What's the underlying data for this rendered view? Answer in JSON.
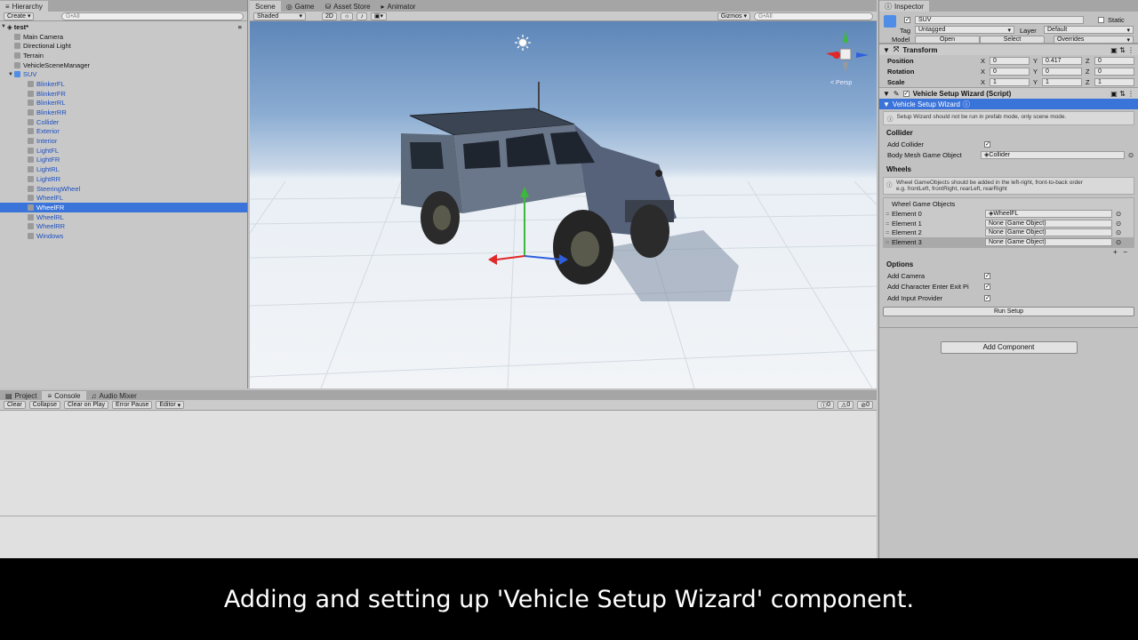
{
  "hierarchy": {
    "tab_label": "Hierarchy",
    "create_label": "Create",
    "search_placeholder": "G•All",
    "scene_name": "test*",
    "roots": [
      "Main Camera",
      "Directional Light",
      "Terrain",
      "VehicleSceneManager",
      "SUV"
    ],
    "children": [
      "BlinkerFL",
      "BlinkerFR",
      "BlinkerRL",
      "BlinkerRR",
      "Collider",
      "Exterior",
      "Interior",
      "LightFL",
      "LightFR",
      "LightRL",
      "LightRR",
      "SteeringWheel",
      "WheelFL",
      "WheelFR",
      "WheelRL",
      "WheelRR",
      "Windows"
    ],
    "selected": "WheelFR"
  },
  "scene": {
    "tabs": [
      "Scene",
      "Game",
      "Asset Store",
      "Animator"
    ],
    "shading": "Shaded",
    "mode_2d": "2D",
    "gizmos": "Gizmos",
    "search_placeholder": "G•All",
    "persp_label": "< Persp"
  },
  "inspector": {
    "tab_label": "Inspector",
    "object_name": "SUV",
    "static_label": "Static",
    "tag_label": "Tag",
    "tag_value": "Untagged",
    "layer_label": "Layer",
    "layer_value": "Default",
    "model_label": "Model",
    "open_label": "Open",
    "select_label": "Select",
    "overrides_label": "Overrides",
    "transform": {
      "title": "Transform",
      "position_label": "Position",
      "rotation_label": "Rotation",
      "scale_label": "Scale",
      "position": {
        "x": "0",
        "y": "0.417",
        "z": "0"
      },
      "rotation": {
        "x": "0",
        "y": "0",
        "z": "0"
      },
      "scale": {
        "x": "1",
        "y": "1",
        "z": "1"
      }
    },
    "wizard": {
      "title": "Vehicle Setup Wizard (Script)",
      "subtitle": "Vehicle Setup Wizard",
      "prefab_note": "Setup Wizard should not be run in prefab mode, only scene mode.",
      "collider_section": "Collider",
      "add_collider_label": "Add Collider",
      "body_mesh_label": "Body Mesh Game Object",
      "body_mesh_value": "Collider",
      "wheels_section": "Wheels",
      "wheels_note_1": "Wheel GameObjects should be added in the left-right, front-to-back order",
      "wheels_note_2": "e.g. frontLeft, frontRight, rearLeft, rearRight",
      "wheel_objects_label": "Wheel Game Objects",
      "elements": [
        {
          "label": "Element 0",
          "value": "WheelFL"
        },
        {
          "label": "Element 1",
          "value": "None (Game Object)"
        },
        {
          "label": "Element 2",
          "value": "None (Game Object)"
        },
        {
          "label": "Element 3",
          "value": "None (Game Object)"
        }
      ],
      "options_section": "Options",
      "add_camera_label": "Add Camera",
      "add_enter_exit_label": "Add Character Enter Exit Pi",
      "add_input_label": "Add Input Provider",
      "run_setup_label": "Run Setup"
    },
    "add_component_label": "Add Component"
  },
  "console": {
    "tabs": [
      "Project",
      "Console",
      "Audio Mixer"
    ],
    "buttons": [
      "Clear",
      "Collapse",
      "Clear on Play",
      "Error Pause",
      "Editor"
    ],
    "counts": [
      "0",
      "0",
      "0"
    ]
  },
  "caption": "Adding and setting up 'Vehicle Setup Wizard' component.",
  "colors": {
    "selection": "#3a73d9",
    "child_text": "#1c4fbf",
    "accent": "#3a73d9"
  }
}
